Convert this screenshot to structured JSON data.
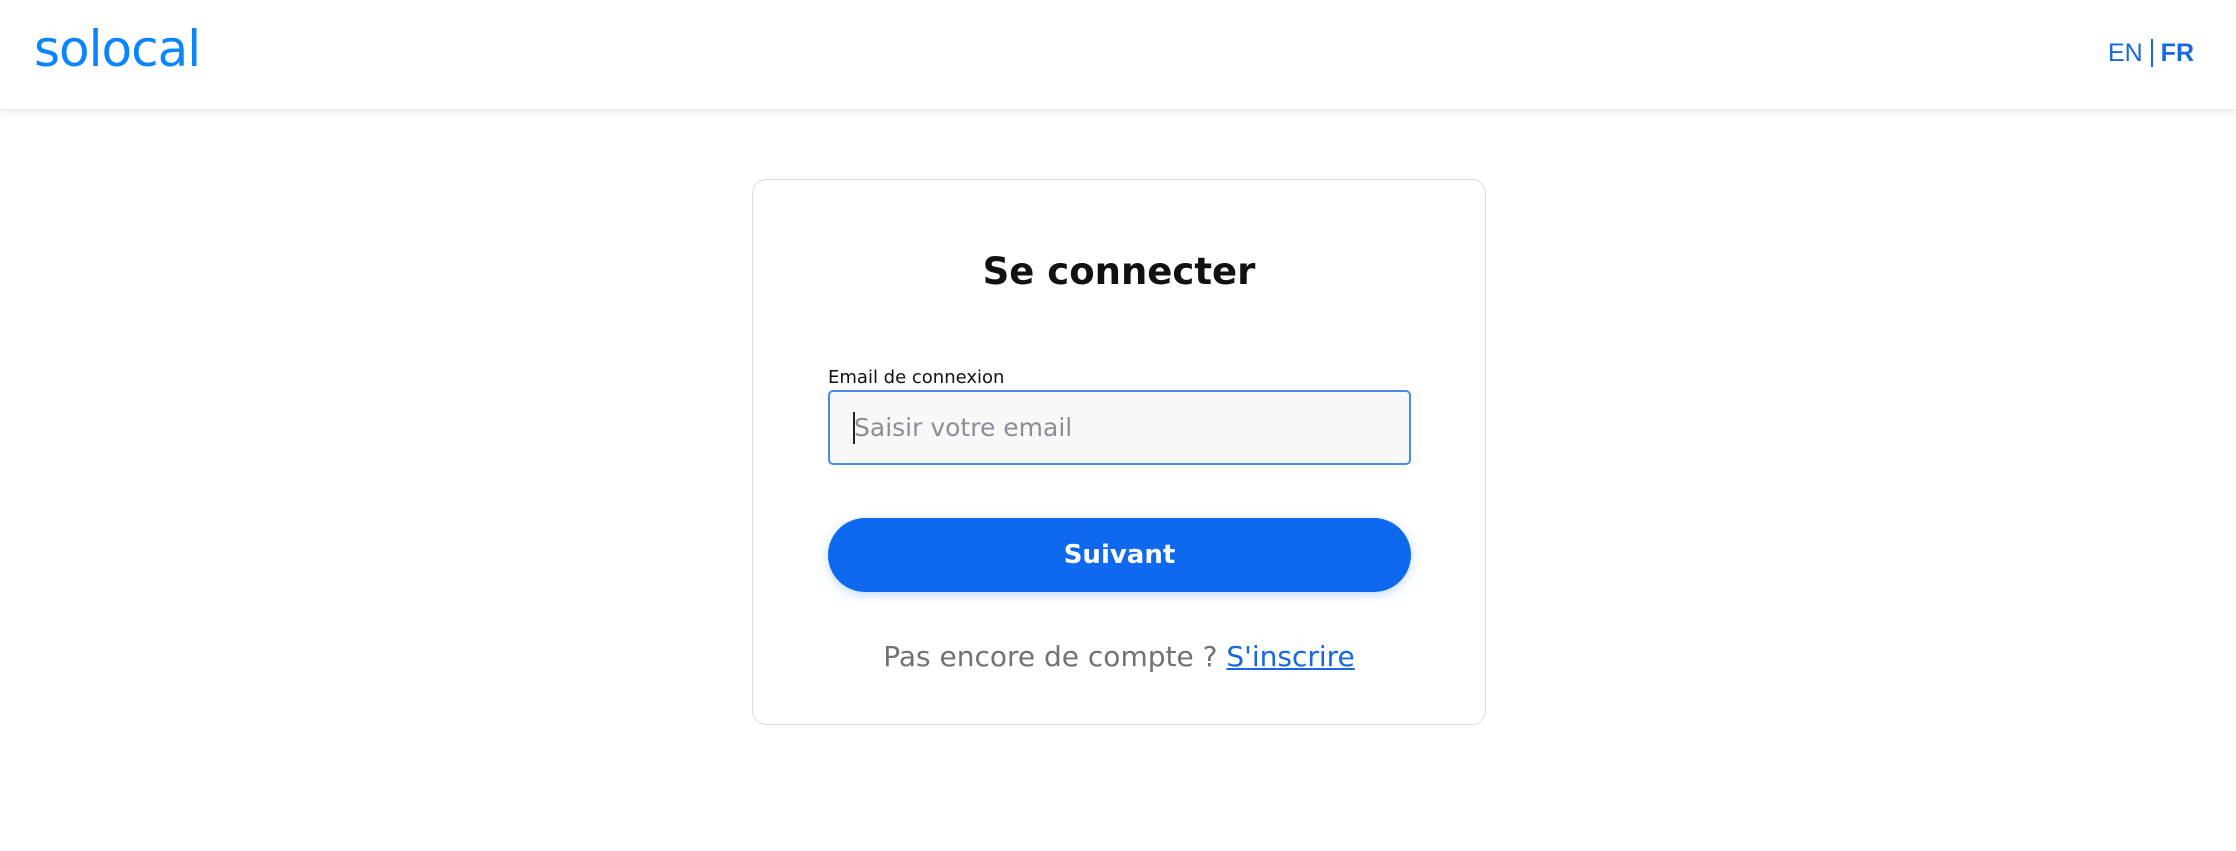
{
  "header": {
    "logo_text": "solocal",
    "lang_en": "EN",
    "lang_fr": "FR"
  },
  "login": {
    "title": "Se connecter",
    "email_label": "Email de connexion",
    "email_placeholder": "Saisir votre email",
    "email_value": "",
    "submit_label": "Suivant",
    "signup_prompt": "Pas encore de compte ? ",
    "signup_link": "S'inscrire"
  },
  "colors": {
    "brand_blue": "#0a84ff",
    "primary_button": "#0f69ef",
    "link_blue": "#1668e3",
    "input_focus_border": "#4a8bea"
  }
}
